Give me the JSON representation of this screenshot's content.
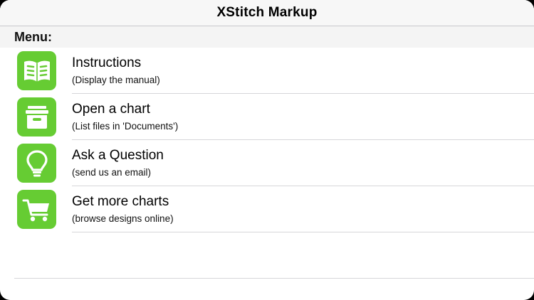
{
  "navbar": {
    "title": "XStitch Markup"
  },
  "menu": {
    "header": "Menu:",
    "items": [
      {
        "title": "Instructions",
        "subtitle": "(Display the manual)",
        "icon": "book-icon"
      },
      {
        "title": "Open a chart",
        "subtitle": "(List files in 'Documents')",
        "icon": "file-drawer-icon"
      },
      {
        "title": "Ask a Question",
        "subtitle": "(send us an email)",
        "icon": "lightbulb-icon"
      },
      {
        "title": "Get more charts",
        "subtitle": "(browse designs online)",
        "icon": "shopping-cart-icon"
      }
    ]
  },
  "colors": {
    "icon_tile": "#66cc33",
    "separator": "#d6d6d9"
  }
}
